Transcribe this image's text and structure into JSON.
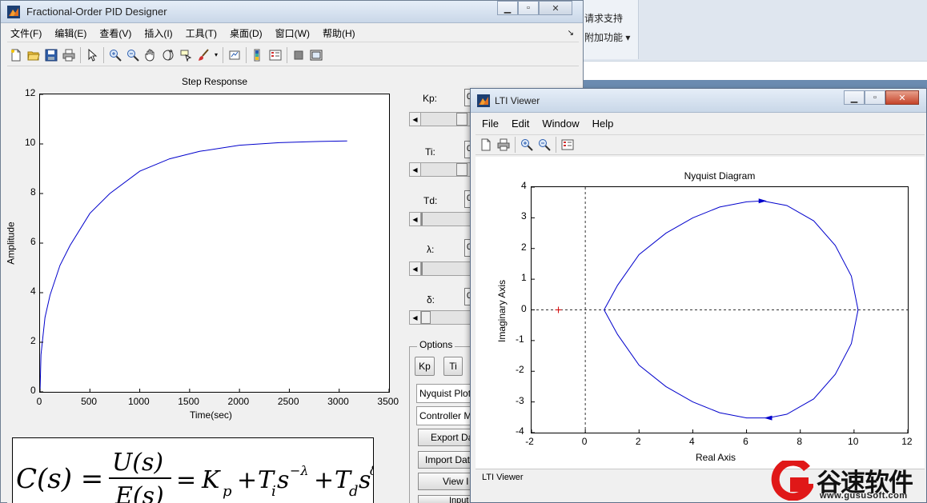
{
  "background": {
    "ribbon_items": [
      "请求支持",
      "附加功能"
    ]
  },
  "main_window": {
    "title": "Fractional-Order PID Designer",
    "menu": [
      "文件(F)",
      "编辑(E)",
      "查看(V)",
      "插入(I)",
      "工具(T)",
      "桌面(D)",
      "窗口(W)",
      "帮助(H)"
    ],
    "step_plot": {
      "title": "Step Response",
      "xlabel": "Time(sec)",
      "ylabel": "Amplitude",
      "xticks": [
        "0",
        "500",
        "1000",
        "1500",
        "2000",
        "2500",
        "3000",
        "3500"
      ],
      "yticks": [
        "0",
        "2",
        "4",
        "6",
        "8",
        "10",
        "12"
      ]
    },
    "params": [
      {
        "label": "Kp:",
        "value": "0"
      },
      {
        "label": "Ti:",
        "value": "0"
      },
      {
        "label": "Td:",
        "value": "0"
      },
      {
        "label": "λ:",
        "value": "0"
      },
      {
        "label": "δ:",
        "value": "0"
      }
    ],
    "options": {
      "legend": "Options",
      "kp_button": "Kp",
      "ti_button": "Ti",
      "plot_type_popup": "Nyquist Plot",
      "controller_popup": "Controller M",
      "export_button": "Export Data",
      "import_button": "Import Data",
      "view_button": "View I",
      "input_button": "Input Your Data"
    },
    "formula": {
      "lhs": "C(s) =",
      "numerator": "U(s)",
      "denominator": "E(s)",
      "rhs": "= K_p + T_i s^-λ + T_d s^δ"
    }
  },
  "lti_viewer": {
    "title": "LTI Viewer",
    "menu": [
      "File",
      "Edit",
      "Window",
      "Help"
    ],
    "status": "LTI Viewer",
    "plot": {
      "title": "Nyquist Diagram",
      "xlabel": "Real Axis",
      "ylabel": "Imaginary Axis",
      "xticks": [
        "-2",
        "0",
        "2",
        "4",
        "6",
        "8",
        "10",
        "12"
      ],
      "yticks": [
        "4",
        "3",
        "2",
        "1",
        "0",
        "-1",
        "-2",
        "-3",
        "-4"
      ]
    }
  },
  "chart_data": [
    {
      "type": "line",
      "title": "Step Response",
      "xlabel": "Time(sec)",
      "ylabel": "Amplitude",
      "xlim": [
        0,
        3500
      ],
      "ylim": [
        0,
        12
      ],
      "series": [
        {
          "x": [
            0,
            10,
            50,
            100,
            200,
            300,
            500,
            700,
            1000,
            1300,
            1600,
            2000,
            2400,
            2800,
            3080
          ],
          "y": [
            0,
            1.5,
            3.0,
            3.9,
            5.1,
            5.9,
            7.2,
            8.0,
            8.9,
            9.4,
            9.7,
            9.95,
            10.05,
            10.1,
            10.12
          ]
        }
      ]
    },
    {
      "type": "line",
      "title": "Nyquist Diagram",
      "xlabel": "Real Axis",
      "ylabel": "Imaginary Axis",
      "xlim": [
        -2,
        12
      ],
      "ylim": [
        -4,
        4
      ],
      "series": [
        {
          "x": [
            0.7,
            1.2,
            2.0,
            3.0,
            4.0,
            5.0,
            6.0,
            6.6,
            7.5,
            8.5,
            9.3,
            9.9,
            10.15,
            9.9,
            9.3,
            8.5,
            7.5,
            6.8,
            6.0,
            5.0,
            4.0,
            3.0,
            2.0,
            1.2,
            0.7
          ],
          "y": [
            0,
            0.8,
            1.8,
            2.5,
            3.0,
            3.35,
            3.52,
            3.55,
            3.4,
            2.9,
            2.1,
            1.1,
            0,
            -1.1,
            -2.1,
            -2.9,
            -3.4,
            -3.52,
            -3.52,
            -3.35,
            -3.0,
            -2.5,
            -1.8,
            -0.8,
            0
          ]
        }
      ],
      "markers": [
        {
          "x": -1,
          "y": 0,
          "symbol": "+",
          "color": "#d00000"
        }
      ]
    }
  ]
}
